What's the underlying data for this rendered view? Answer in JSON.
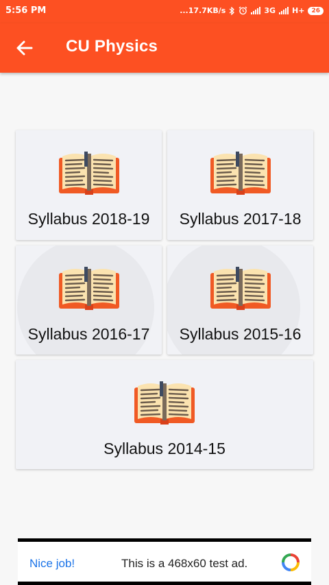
{
  "status_bar": {
    "time": "5:56 PM",
    "network_speed": "...17.7KB/s",
    "network_type": "3G",
    "network_type_2": "H+",
    "battery": "26",
    "icons": [
      "bluetooth-icon",
      "alarm-icon",
      "signal-icon",
      "battery-icon"
    ]
  },
  "app_bar": {
    "title": "CU Physics",
    "back_icon": "arrow-left-icon",
    "color": "#fd5022"
  },
  "cards": [
    {
      "label": "Syllabus 2018-19",
      "icon": "open-book-icon"
    },
    {
      "label": "Syllabus 2017-18",
      "icon": "open-book-icon"
    },
    {
      "label": "Syllabus 2016-17",
      "icon": "open-book-icon"
    },
    {
      "label": "Syllabus 2015-16",
      "icon": "open-book-icon"
    },
    {
      "label": "Syllabus 2014-15",
      "icon": "open-book-icon"
    }
  ],
  "ad": {
    "nice": "Nice job!",
    "text": "This is a 468x60 test ad."
  }
}
